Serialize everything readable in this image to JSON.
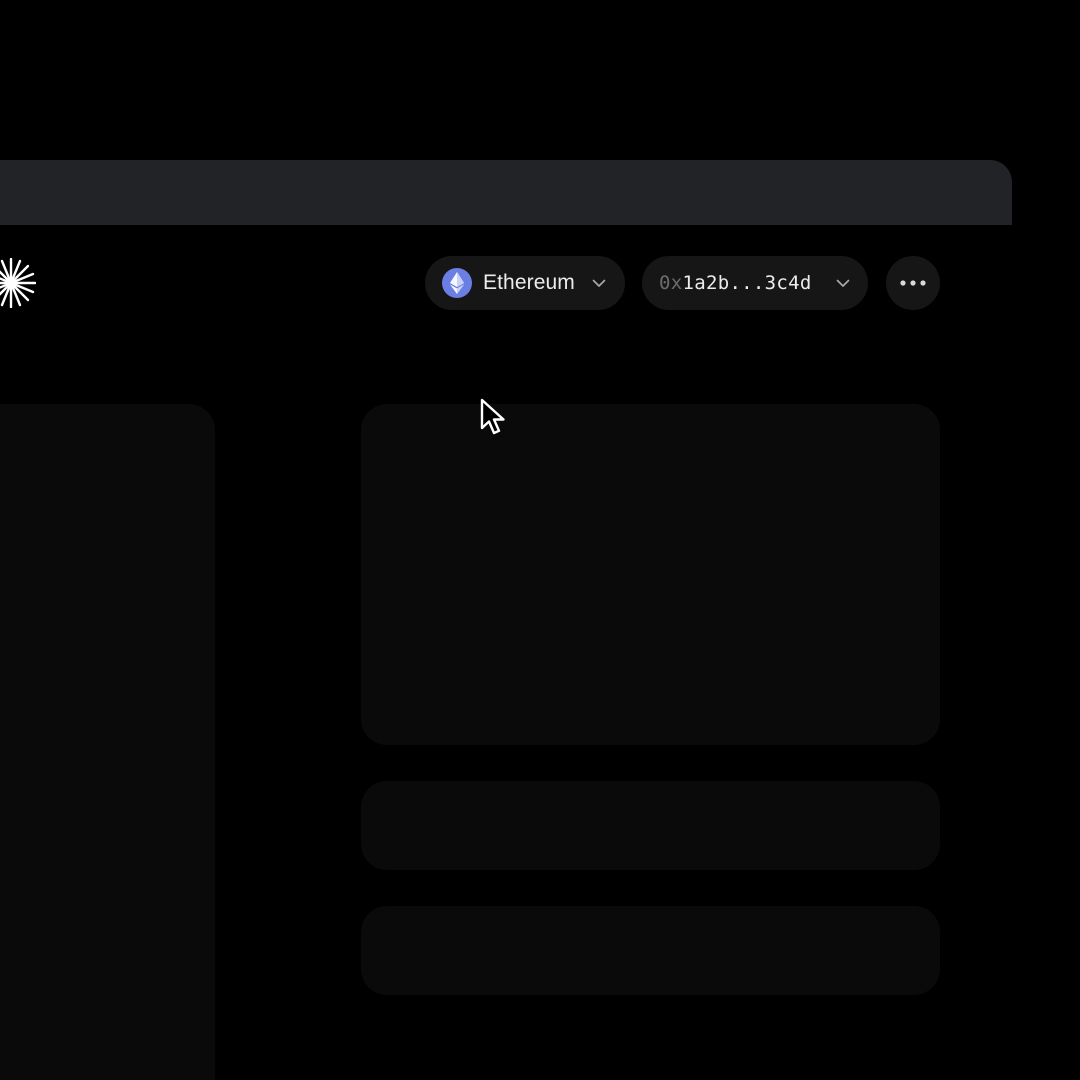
{
  "header": {
    "network": {
      "label": "Ethereum",
      "icon": "ethereum-icon",
      "badge_color": "#6b7ee3"
    },
    "account": {
      "address_prefix": "0x",
      "address_rest": "1a2b...3c4d"
    },
    "more_icon": "more-horizontal-icon"
  },
  "theme": {
    "background": "#000000",
    "titlebar": "#222326",
    "pill": "#161616",
    "panel": "#0a0a0a"
  }
}
